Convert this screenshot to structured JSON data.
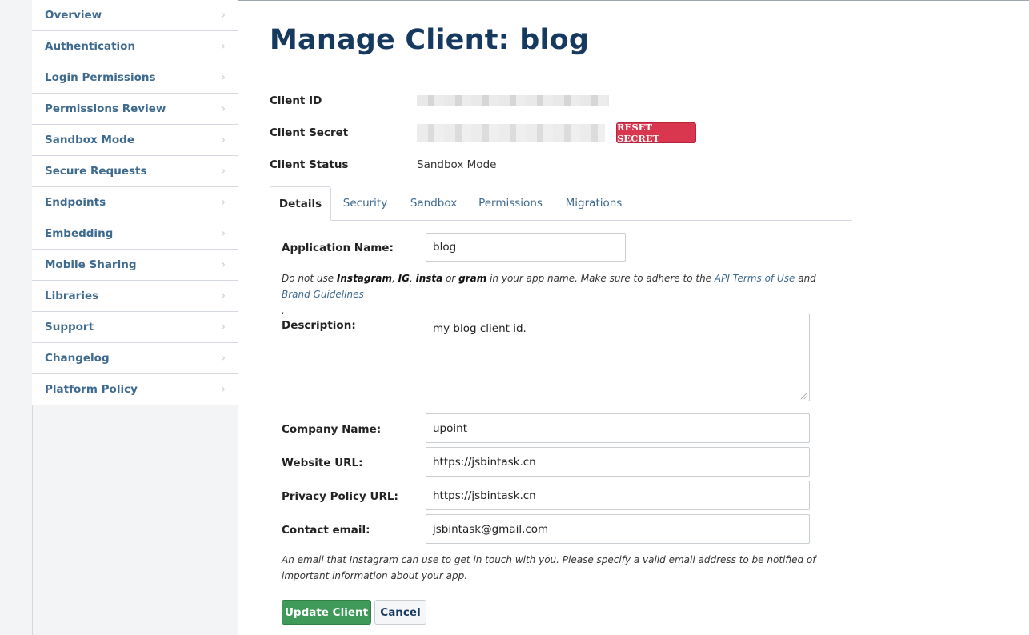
{
  "sidebar": {
    "items": [
      {
        "label": "Overview",
        "name": "sidebar-item-overview"
      },
      {
        "label": "Authentication",
        "name": "sidebar-item-authentication"
      },
      {
        "label": "Login Permissions",
        "name": "sidebar-item-login-permissions"
      },
      {
        "label": "Permissions Review",
        "name": "sidebar-item-permissions-review"
      },
      {
        "label": "Sandbox Mode",
        "name": "sidebar-item-sandbox-mode"
      },
      {
        "label": "Secure Requests",
        "name": "sidebar-item-secure-requests"
      },
      {
        "label": "Endpoints",
        "name": "sidebar-item-endpoints"
      },
      {
        "label": "Embedding",
        "name": "sidebar-item-embedding"
      },
      {
        "label": "Mobile Sharing",
        "name": "sidebar-item-mobile-sharing"
      },
      {
        "label": "Libraries",
        "name": "sidebar-item-libraries"
      },
      {
        "label": "Support",
        "name": "sidebar-item-support"
      },
      {
        "label": "Changelog",
        "name": "sidebar-item-changelog"
      },
      {
        "label": "Platform Policy",
        "name": "sidebar-item-platform-policy"
      }
    ],
    "chevron_icon": "chevron-right-icon"
  },
  "main": {
    "title": "Manage Client: blog",
    "client_info": {
      "id_label": "Client ID",
      "secret_label": "Client Secret",
      "reset_button": "RESET SECRET",
      "status_label": "Client Status",
      "status_value": "Sandbox Mode"
    },
    "tabs": [
      {
        "label": "Details",
        "active": true
      },
      {
        "label": "Security",
        "active": false
      },
      {
        "label": "Sandbox",
        "active": false
      },
      {
        "label": "Permissions",
        "active": false
      },
      {
        "label": "Migrations",
        "active": false
      }
    ],
    "form": {
      "app_name_label": "Application Name:",
      "app_name_value": "blog",
      "name_help": {
        "prefix": "Do not use ",
        "w1": "Instagram",
        "sep1": ", ",
        "w2": "IG",
        "sep2": ", ",
        "w3": "insta",
        "sep3": " or ",
        "w4": "gram",
        "mid": " in your app name. Make sure to adhere to the ",
        "link1": "API Terms of Use",
        "and": " and ",
        "link2": "Brand Guidelines",
        "end": "."
      },
      "description_label": "Description:",
      "description_value": "my blog client id.",
      "company_label": "Company Name:",
      "company_value": "upoint",
      "website_label": "Website URL:",
      "website_value": "https://jsbintask.cn",
      "privacy_label": "Privacy Policy URL:",
      "privacy_value": "https://jsbintask.cn",
      "email_label": "Contact email:",
      "email_value": "jsbintask@gmail.com",
      "email_help": "An email that Instagram can use to get in touch with you. Please specify a valid email address to be notified of important information about your app.",
      "update_button": "Update Client",
      "cancel_button": "Cancel"
    }
  },
  "colors": {
    "heading": "#163a5f",
    "link": "#3d6a8e",
    "danger": "#d9364f",
    "success": "#3f9a5a"
  }
}
